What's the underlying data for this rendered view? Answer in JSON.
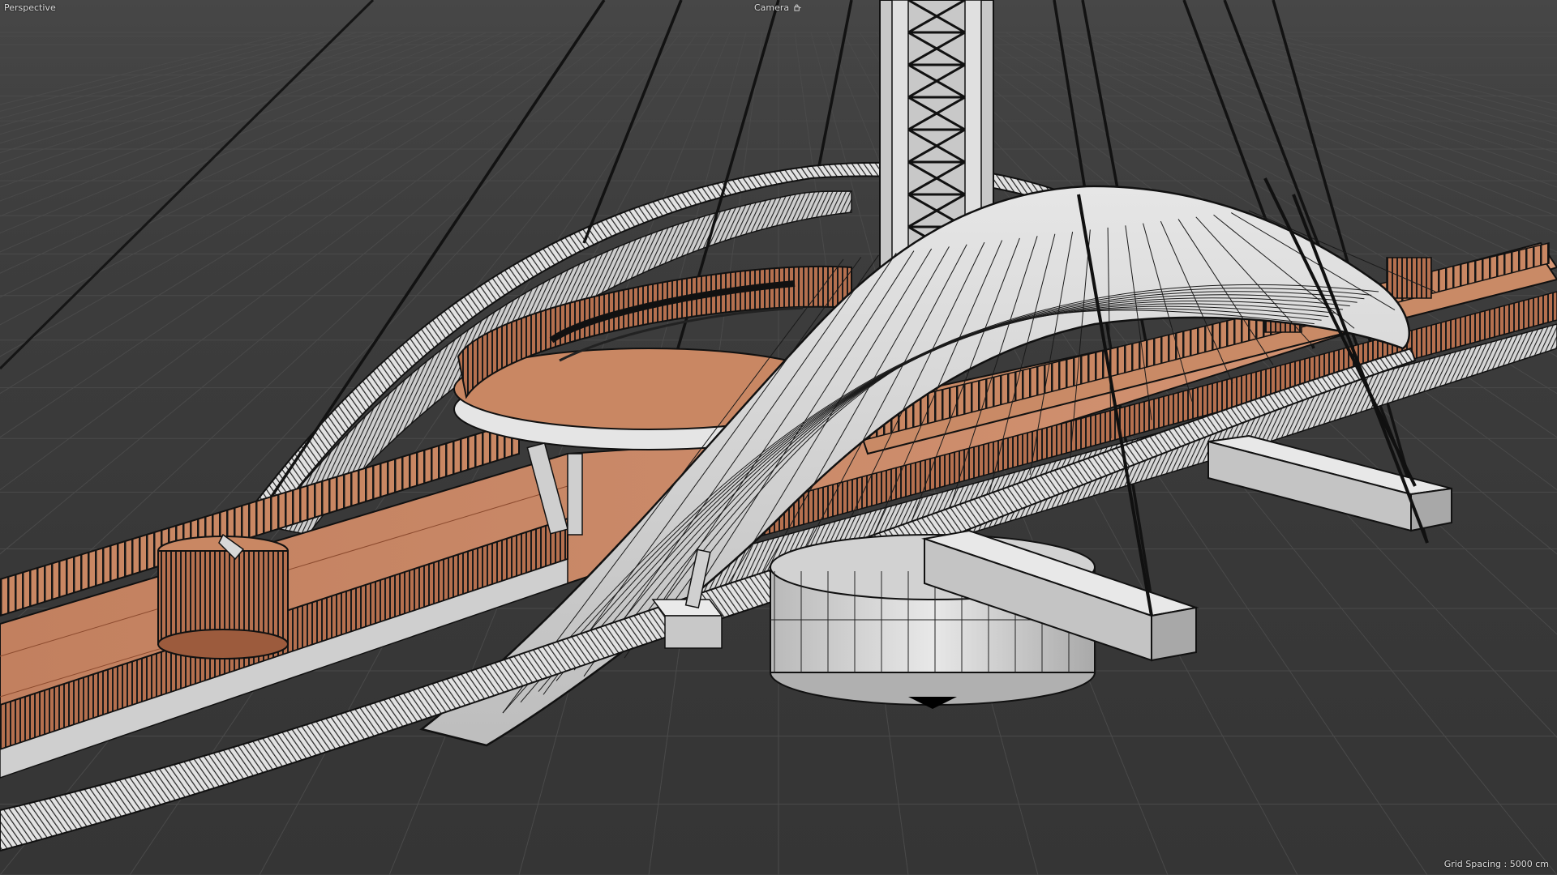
{
  "viewport": {
    "view_name": "Perspective",
    "camera_label": "Camera",
    "camera_icon": "camera-lock-icon",
    "grid_spacing": "Grid Spacing : 5000 cm"
  },
  "colors": {
    "background": "#3b3b3b",
    "grid_line": "#4a4a4a",
    "wire": "#111111",
    "surface": "#d8d8d8",
    "deck": "#c98763",
    "deck_dark": "#8c4e33",
    "pylon": "#bdbdbd"
  },
  "scene": {
    "object": "cable-stayed pedestrian bridge",
    "elements": [
      "pylon-tower",
      "stay-cables",
      "curved-roof-shell",
      "walkway-deck",
      "railings",
      "cylindrical-pier",
      "cross-beams",
      "lookout-platform",
      "ribbon-arches"
    ]
  }
}
